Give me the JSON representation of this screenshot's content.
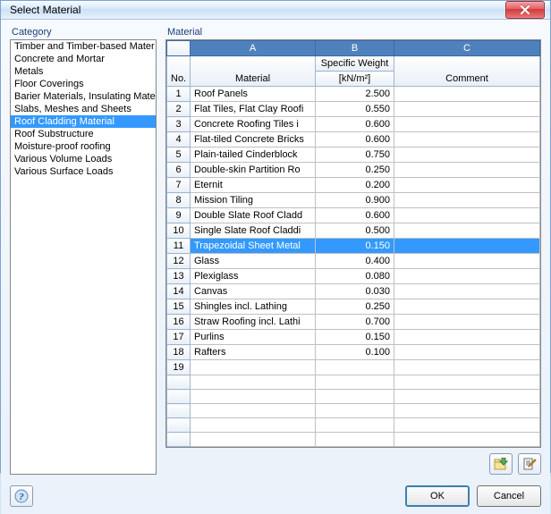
{
  "window": {
    "title": "Select Material"
  },
  "panels": {
    "category": "Category",
    "material": "Material"
  },
  "categories": {
    "items": [
      "Timber and Timber-based Mater",
      "Concrete and Mortar",
      "Metals",
      "Floor Coverings",
      "Barier Materials, Insulating Mate",
      "Slabs, Meshes and Sheets",
      "Roof Cladding Material",
      "Roof Substructure",
      "Moisture-proof roofing",
      "Various Volume Loads",
      "Various Surface Loads"
    ],
    "selected_index": 6
  },
  "grid": {
    "col_letters": [
      "A",
      "B",
      "C"
    ],
    "headers": {
      "no": "No.",
      "material": "Material",
      "weight_line1": "Specific Weight",
      "weight_line2": "[kN/m²]",
      "comment": "Comment"
    },
    "selected_row": 11,
    "rows": [
      {
        "n": 1,
        "mat": "Roof Panels",
        "w": "2.500",
        "c": ""
      },
      {
        "n": 2,
        "mat": "Flat Tiles, Flat Clay Roofi",
        "w": "0.550",
        "c": ""
      },
      {
        "n": 3,
        "mat": "Concrete Roofing Tiles i",
        "w": "0.600",
        "c": ""
      },
      {
        "n": 4,
        "mat": "Flat-tiled Concrete Bricks",
        "w": "0.600",
        "c": ""
      },
      {
        "n": 5,
        "mat": "Plain-tailed Cinderblock",
        "w": "0.750",
        "c": ""
      },
      {
        "n": 6,
        "mat": "Double-skin Partition Ro",
        "w": "0.250",
        "c": ""
      },
      {
        "n": 7,
        "mat": "Eternit",
        "w": "0.200",
        "c": ""
      },
      {
        "n": 8,
        "mat": "Mission Tiling",
        "w": "0.900",
        "c": ""
      },
      {
        "n": 9,
        "mat": "Double Slate Roof Cladd",
        "w": "0.600",
        "c": ""
      },
      {
        "n": 10,
        "mat": "Single Slate Roof Claddi",
        "w": "0.500",
        "c": ""
      },
      {
        "n": 11,
        "mat": "Trapezoidal Sheet Metal",
        "w": "0.150",
        "c": ""
      },
      {
        "n": 12,
        "mat": "Glass",
        "w": "0.400",
        "c": ""
      },
      {
        "n": 13,
        "mat": "Plexiglass",
        "w": "0.080",
        "c": ""
      },
      {
        "n": 14,
        "mat": "Canvas",
        "w": "0.030",
        "c": ""
      },
      {
        "n": 15,
        "mat": "Shingles incl. Lathing",
        "w": "0.250",
        "c": ""
      },
      {
        "n": 16,
        "mat": "Straw Roofing incl. Lathi",
        "w": "0.700",
        "c": ""
      },
      {
        "n": 17,
        "mat": "Purlins",
        "w": "0.150",
        "c": ""
      },
      {
        "n": 18,
        "mat": "Rafters",
        "w": "0.100",
        "c": ""
      },
      {
        "n": 19,
        "mat": "",
        "w": "",
        "c": ""
      }
    ]
  },
  "icons": {
    "import": "import-icon",
    "edit": "edit-icon",
    "help": "help-icon",
    "close": "close-icon"
  },
  "buttons": {
    "ok": "OK",
    "cancel": "Cancel"
  },
  "colors": {
    "selection": "#3399ff",
    "header_blue": "#4f81bd"
  }
}
